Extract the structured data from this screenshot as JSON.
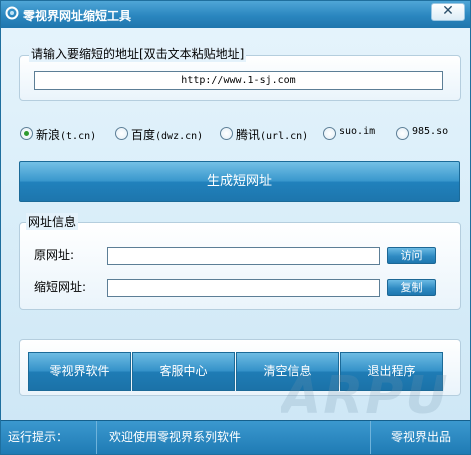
{
  "window": {
    "title": "零视界网址缩短工具",
    "close_glyph": "✕"
  },
  "url_group": {
    "label": "请输入要缩短的地址[双击文本粘贴地址]",
    "value": "http://www.1-sj.com"
  },
  "services": [
    {
      "label": "新浪",
      "domain": "(t.cn)",
      "selected": true
    },
    {
      "label": "百度",
      "domain": "(dwz.cn)",
      "selected": false
    },
    {
      "label": "腾讯",
      "domain": "(url.cn)",
      "selected": false
    },
    {
      "label": "",
      "domain": "suo.im",
      "selected": false
    },
    {
      "label": "",
      "domain": "985.so",
      "selected": false
    }
  ],
  "generate_label": "生成短网址",
  "info_group": {
    "label": "网址信息",
    "original_label": "原网址:",
    "original_value": "",
    "short_label": "缩短网址:",
    "short_value": "",
    "visit_label": "访问",
    "copy_label": "复制"
  },
  "buttons": {
    "software": "零视界软件",
    "service": "客服中心",
    "clear": "清空信息",
    "exit": "退出程序"
  },
  "status": {
    "prefix": "运行提示：",
    "message": "欢迎使用零视界系列软件",
    "brand": "零视界出品"
  },
  "colors": {
    "title_bar": "#2a86bf",
    "button_blue": "#2181bc",
    "status_bar": "#1f7bb4",
    "radio_selected": "#2f9a2f"
  }
}
